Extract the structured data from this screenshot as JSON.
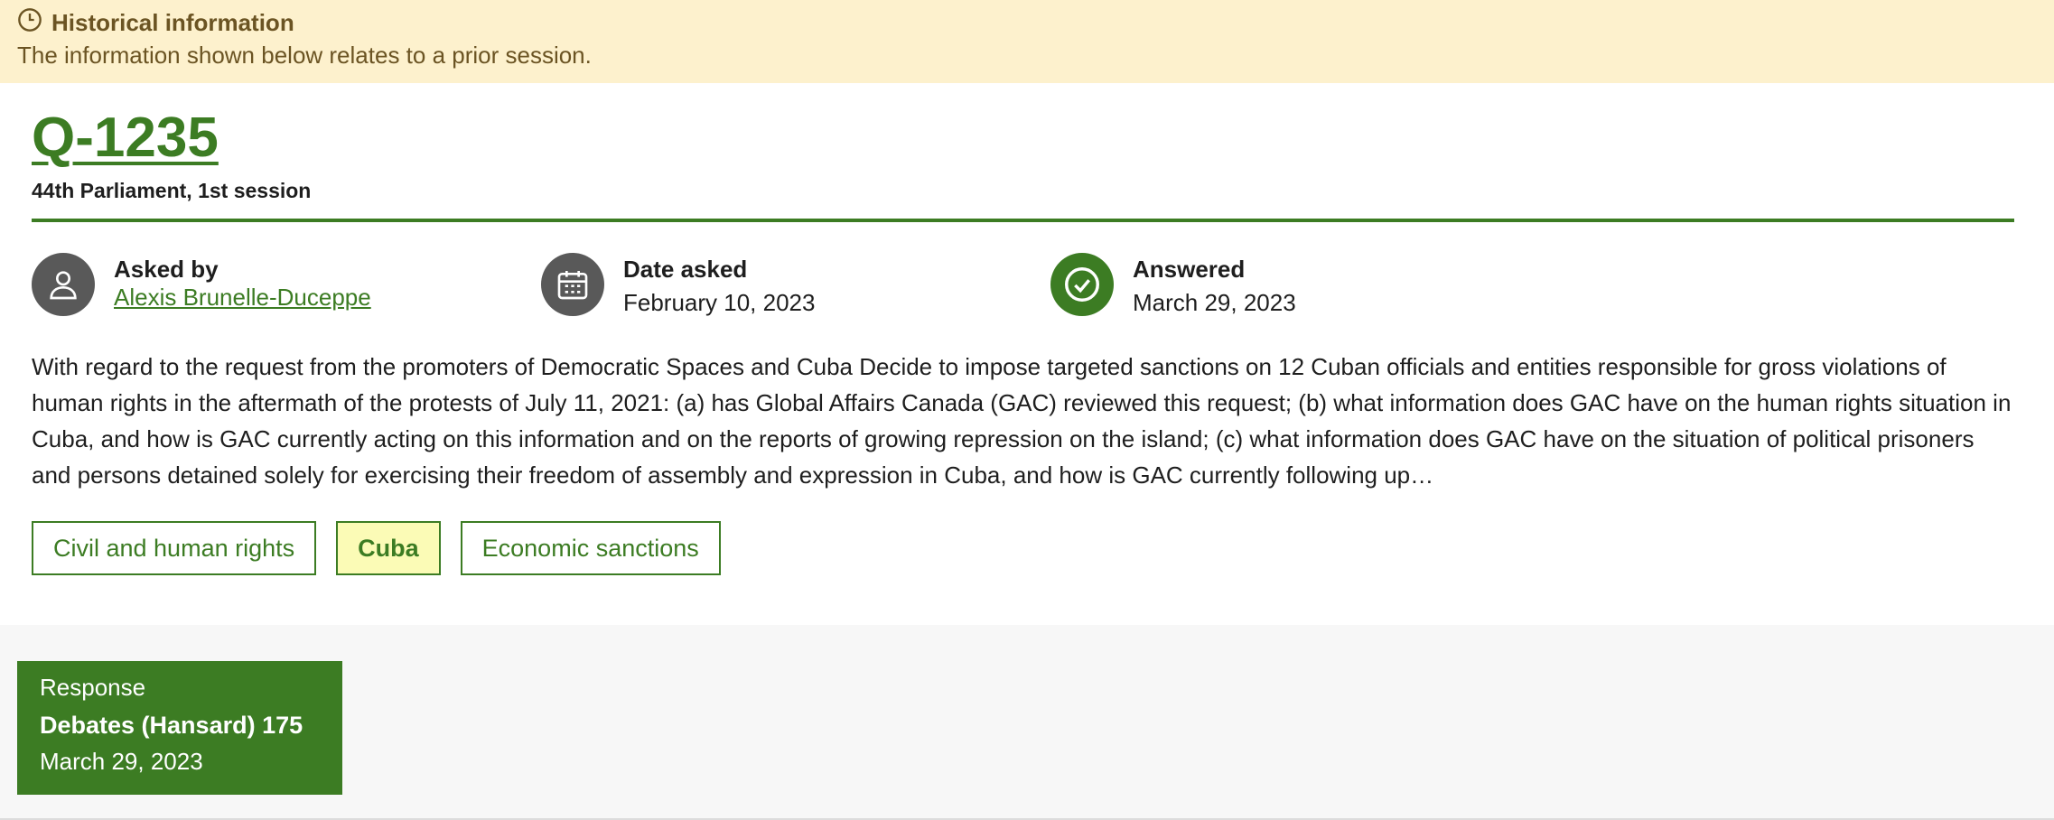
{
  "banner": {
    "title": "Historical information",
    "text": "The information shown below relates to a prior session."
  },
  "question": {
    "number": "Q-1235",
    "session": "44th Parliament, 1st session",
    "asked_by_label": "Asked by",
    "asked_by": "Alexis Brunelle-Duceppe",
    "date_asked_label": "Date asked",
    "date_asked": "February 10, 2023",
    "answered_label": "Answered",
    "answered": "March 29, 2023",
    "text": "With regard to the request from the promoters of Democratic Spaces and Cuba Decide to impose targeted sanctions on 12 Cuban officials and entities responsible for gross violations of human rights in the aftermath of the protests of July 11, 2021: (a) has Global Affairs Canada (GAC) reviewed this request; (b) what information does GAC have on the human rights situation in Cuba, and how is GAC currently acting on this information and on the reports of growing repression on the island; (c) what information does GAC have on the situation of political prisoners and persons detained solely for exercising their freedom of assembly and expression in Cuba, and how is GAC currently following up…"
  },
  "tags": [
    "Civil and human rights",
    "Cuba",
    "Economic sanctions"
  ],
  "response": {
    "label": "Response",
    "title": "Debates (Hansard) 175",
    "date": "March 29, 2023"
  },
  "colors": {
    "accent": "#3c7c23",
    "banner_bg": "#fdf1cd",
    "highlight_tag_bg": "#fbfbb6"
  }
}
